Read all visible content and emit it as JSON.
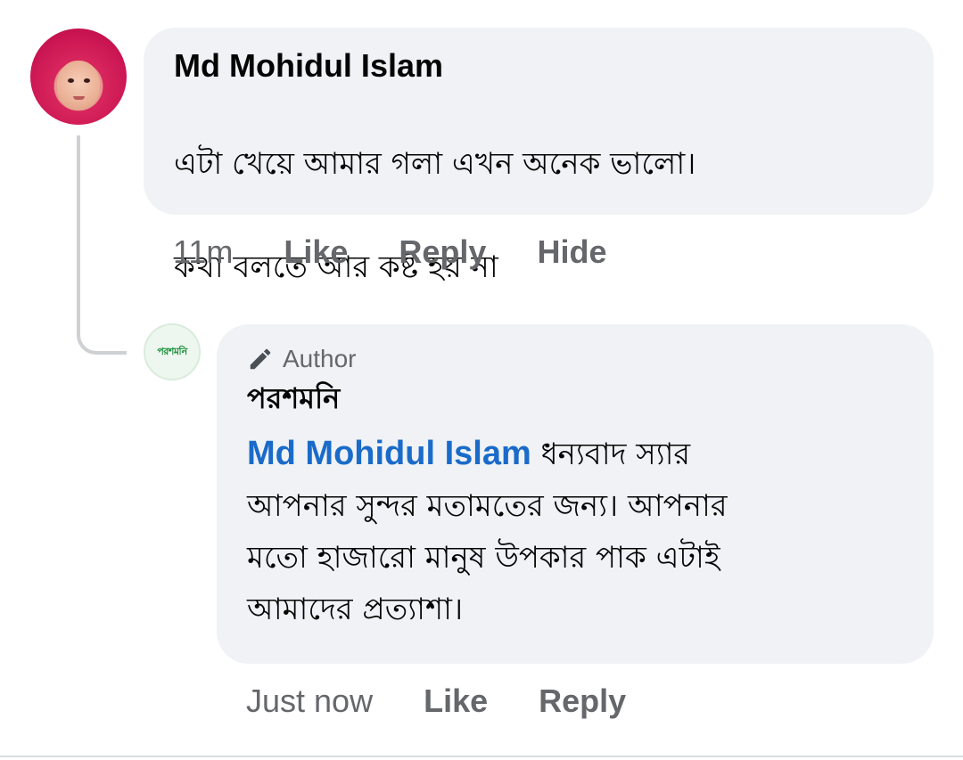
{
  "comment": {
    "author": "Md Mohidul Islam",
    "text_line1": "এটা খেয়ে আমার গলা এখন অনেক ভালো।",
    "text_line2": "কথা বলতে আর কষ্ট হয় না",
    "timestamp": "11m",
    "like_label": "Like",
    "reply_label": "Reply",
    "hide_label": "Hide"
  },
  "reply": {
    "badge_label": "Author",
    "badge_icon": "pencil-icon",
    "page_name": "পরশমনি",
    "avatar_logo_text": "পরশমনি",
    "mention": "Md Mohidul Islam",
    "text_first": " ধন্যবাদ স্যার",
    "text_line2": "আপনার সুন্দর মতামতের জন্য। আপনার",
    "text_line3": "মতো হাজারো মানুষ উপকার পাক এটাই",
    "text_line4": "আমাদের প্রত্যাশা।",
    "timestamp": "Just now",
    "like_label": "Like",
    "reply_label": "Reply"
  },
  "colors": {
    "bubble": "#f0f2f5",
    "meta_text": "#65676b",
    "mention": "#1a6bc9",
    "thread_line": "#ced0d4"
  }
}
